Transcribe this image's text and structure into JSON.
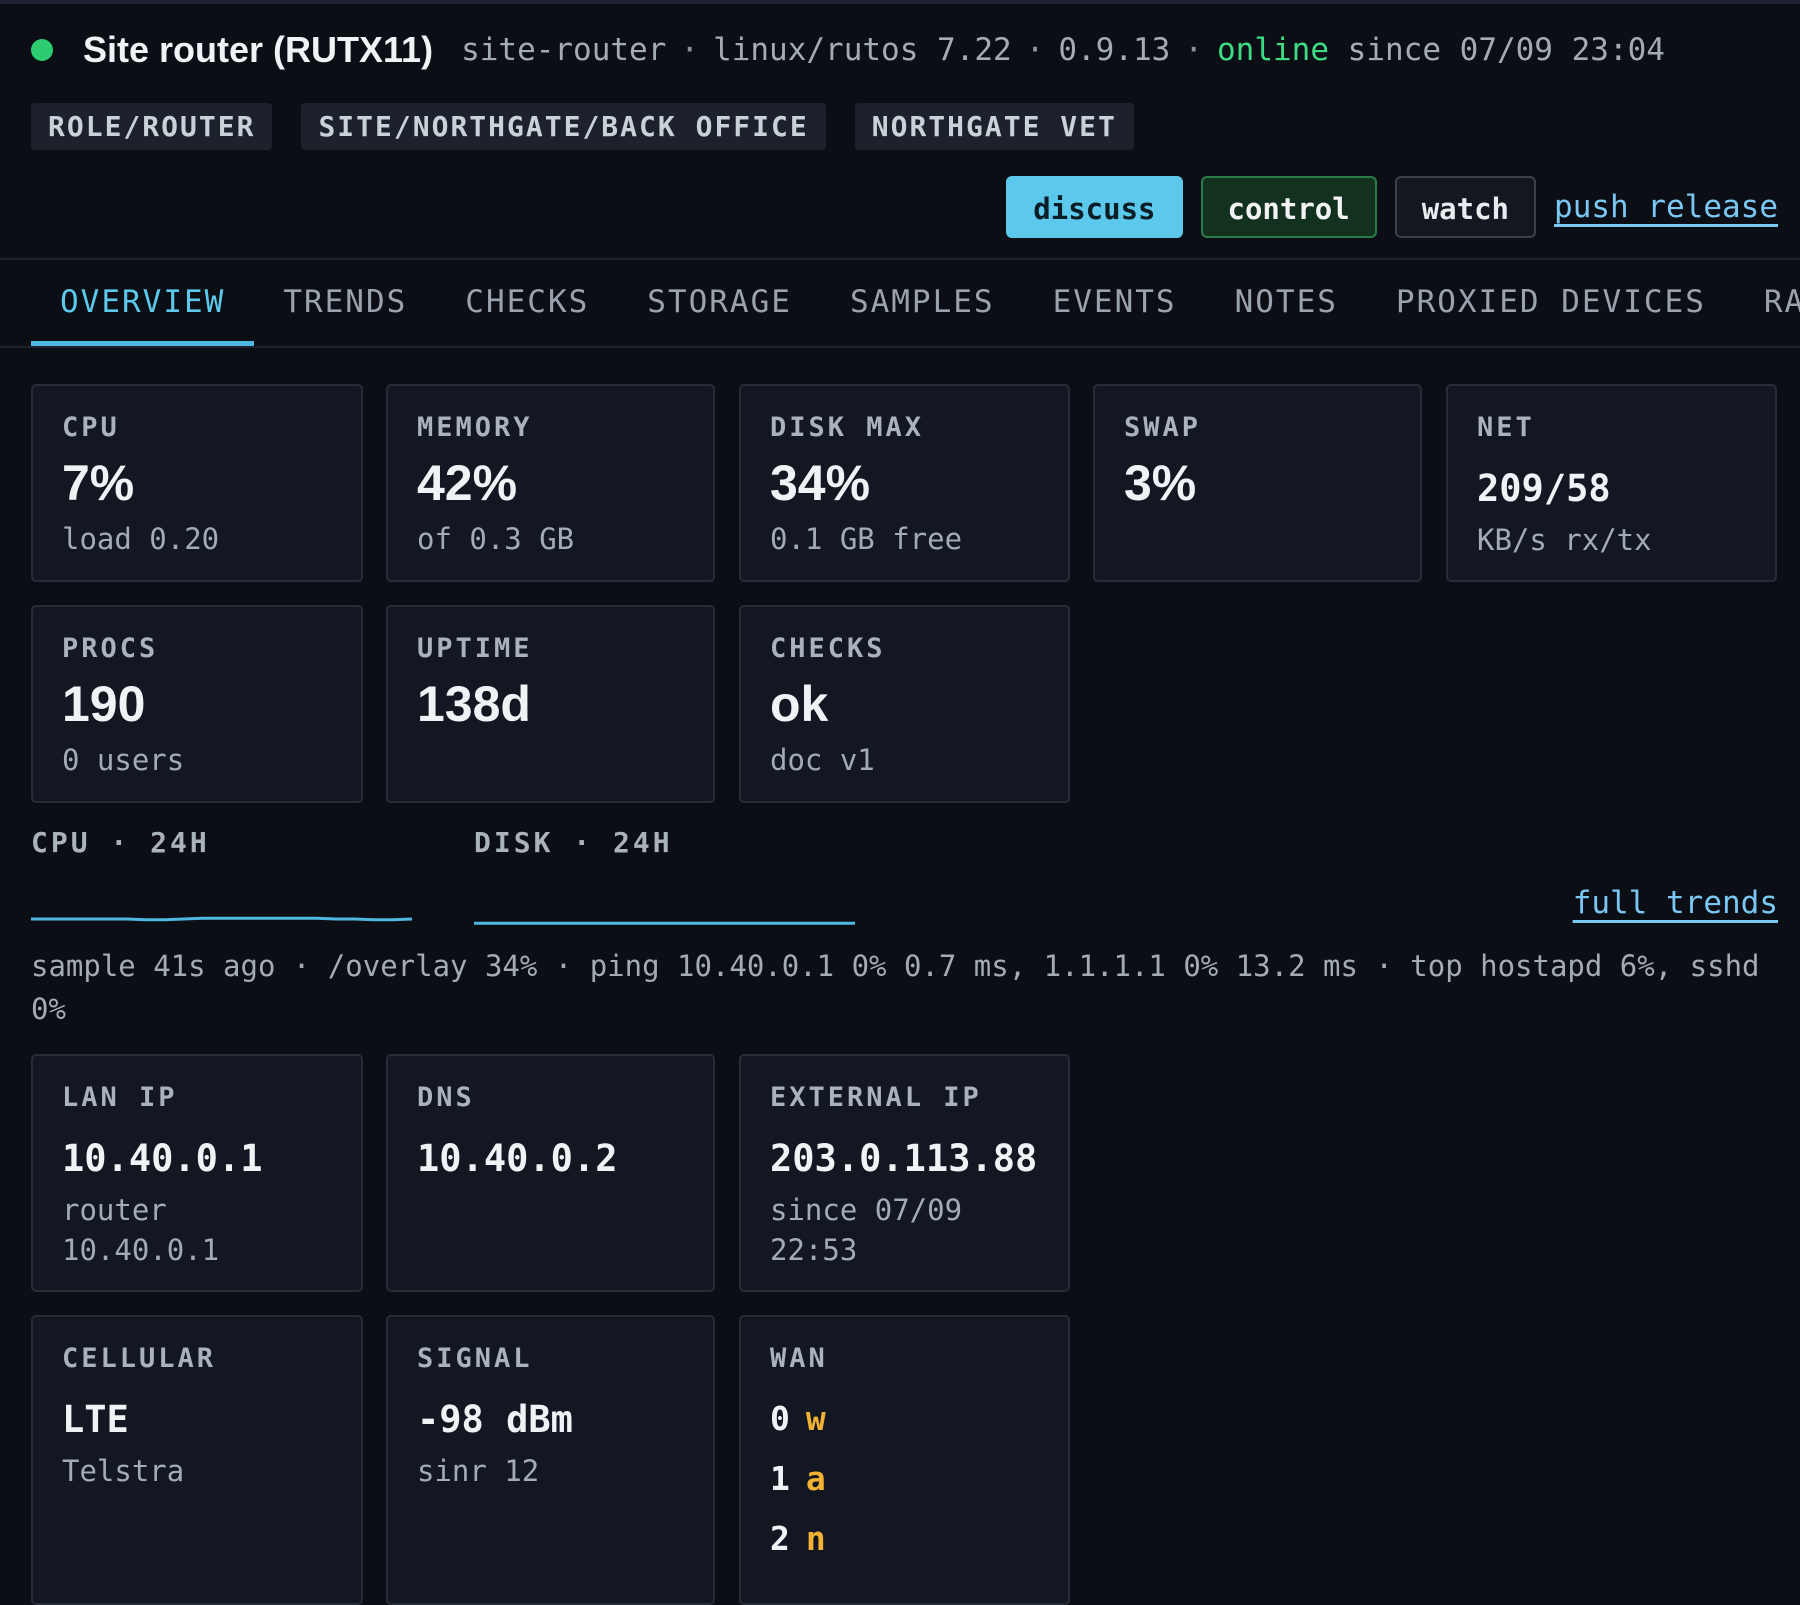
{
  "header": {
    "status_color": "#2ecc71",
    "title": "Site router (RUTX11)",
    "hostname": "site-router",
    "os": "linux/rutos 7.22",
    "agent_version": "0.9.13",
    "status": "online",
    "since": "since 07/09 23:04",
    "separator": "·"
  },
  "tags": [
    "ROLE/ROUTER",
    "SITE/NORTHGATE/BACK OFFICE",
    "NORTHGATE VET"
  ],
  "actions": {
    "discuss": "discuss",
    "control": "control",
    "watch": "watch",
    "push_release": "push release"
  },
  "tabs": [
    "OVERVIEW",
    "TRENDS",
    "CHECKS",
    "STORAGE",
    "SAMPLES",
    "EVENTS",
    "NOTES",
    "PROXIED DEVICES",
    "RA"
  ],
  "active_tab": "OVERVIEW",
  "stats": {
    "cpu": {
      "label": "CPU",
      "value": "7%",
      "sub": "load 0.20"
    },
    "memory": {
      "label": "MEMORY",
      "value": "42%",
      "sub": "of 0.3 GB"
    },
    "disk": {
      "label": "DISK MAX",
      "value": "34%",
      "sub": "0.1 GB free"
    },
    "swap": {
      "label": "SWAP",
      "value": "3%"
    },
    "net": {
      "label": "NET",
      "value": "209/58",
      "sub": "KB/s rx/tx"
    },
    "procs": {
      "label": "PROCS",
      "value": "190",
      "sub": "0 users"
    },
    "uptime": {
      "label": "UPTIME",
      "value": "138d"
    },
    "checks": {
      "label": "CHECKS",
      "value": "ok",
      "sub": "doc v1"
    }
  },
  "trends": {
    "cpu_label": "CPU · 24H",
    "disk_label": "DISK · 24H",
    "full_trends": "full trends",
    "cpu_series": [
      7,
      7,
      7,
      7,
      7,
      7,
      6,
      6,
      7,
      8,
      8,
      8,
      8,
      8,
      8,
      8,
      7,
      7,
      6,
      6,
      7
    ],
    "disk_series": [
      34,
      34,
      34,
      34,
      34,
      34,
      34,
      34,
      34,
      34,
      34,
      34,
      34,
      34,
      34,
      34,
      34,
      34,
      34,
      34,
      34
    ],
    "sample_text": "sample 41s ago · /overlay 34% · ping 10.40.0.1 0% 0.7 ms, 1.1.1.1 0% 13.2 ms · top hostapd 6%, sshd 0%"
  },
  "network": {
    "lan": {
      "label": "LAN IP",
      "value": "10.40.0.1",
      "sub": "router 10.40.0.1"
    },
    "dns": {
      "label": "DNS",
      "value": "10.40.0.2"
    },
    "external": {
      "label": "EXTERNAL IP",
      "value": "203.0.113.88",
      "sub": "since 07/09 22:53"
    },
    "cellular": {
      "label": "CELLULAR",
      "value": "LTE",
      "sub": "Telstra"
    },
    "signal": {
      "label": "SIGNAL",
      "value": "-98 dBm",
      "sub": "sinr 12"
    },
    "wan": {
      "label": "WAN",
      "rows": [
        {
          "idx": "0",
          "val": "w"
        },
        {
          "idx": "1",
          "val": "a"
        },
        {
          "idx": "2",
          "val": "n"
        }
      ]
    }
  },
  "colors": {
    "accent": "#5cc9ec",
    "online": "#3ddc84",
    "wan_value": "#f2b233",
    "spark_cpu": "#4fb8e0",
    "spark_disk": "#4fb8e0"
  }
}
